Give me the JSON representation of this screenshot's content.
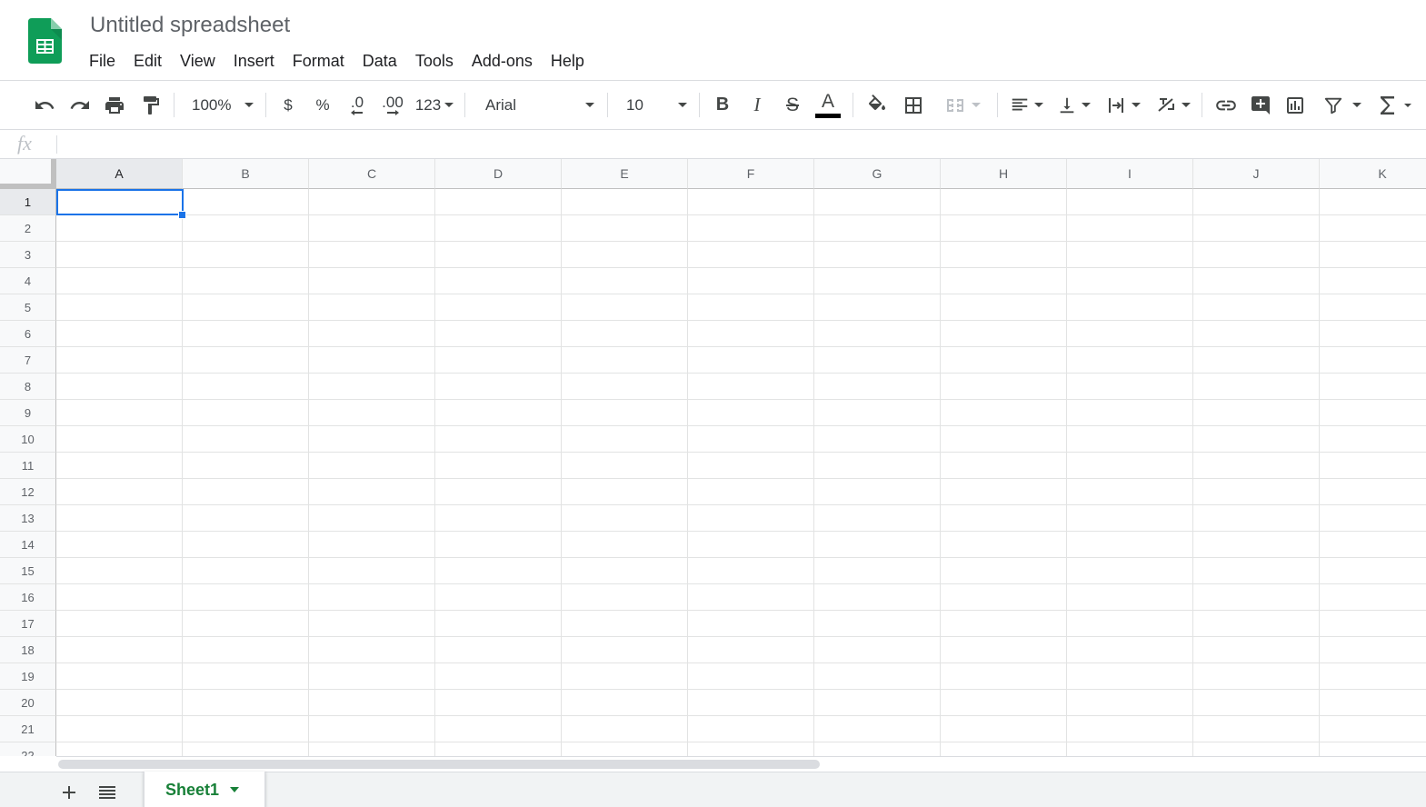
{
  "app": {
    "title": "Untitled spreadsheet",
    "logo_icon": "google-sheets-logo",
    "brand_color": "#0f9d58"
  },
  "menu": [
    "File",
    "Edit",
    "View",
    "Insert",
    "Format",
    "Data",
    "Tools",
    "Add-ons",
    "Help"
  ],
  "toolbar": {
    "zoom": "100%",
    "currency_symbol": "$",
    "percent_symbol": "%",
    "decrease_decimal_label": ".0",
    "increase_decimal_label": ".00",
    "more_formats_label": "123",
    "font": "Arial",
    "font_size": "10",
    "bold_label": "B",
    "italic_label": "I",
    "strikethrough_label": "S",
    "text_color_label": "A",
    "text_color": "#000000",
    "icons": [
      "undo-icon",
      "redo-icon",
      "print-icon",
      "paint-format-icon",
      "fill-color-icon",
      "borders-icon",
      "merge-cells-icon",
      "horizontal-align-icon",
      "vertical-align-icon",
      "text-wrapping-icon",
      "text-rotation-icon",
      "insert-link-icon",
      "insert-comment-icon",
      "insert-chart-icon",
      "filter-icon",
      "functions-icon"
    ]
  },
  "formula_bar": {
    "fx_label": "fx",
    "value": ""
  },
  "grid": {
    "columns": [
      "A",
      "B",
      "C",
      "D",
      "E",
      "F",
      "G",
      "H",
      "I",
      "J",
      "K"
    ],
    "rows": [
      "1",
      "2",
      "3",
      "4",
      "5",
      "6",
      "7",
      "8",
      "9",
      "10",
      "11",
      "12",
      "13",
      "14",
      "15",
      "16",
      "17",
      "18",
      "19",
      "20",
      "21",
      "22"
    ],
    "selected_cell": "A1",
    "selection_color": "#1a73e8"
  },
  "sheets": {
    "tabs": [
      "Sheet1"
    ],
    "active": "Sheet1",
    "active_color": "#188038"
  }
}
